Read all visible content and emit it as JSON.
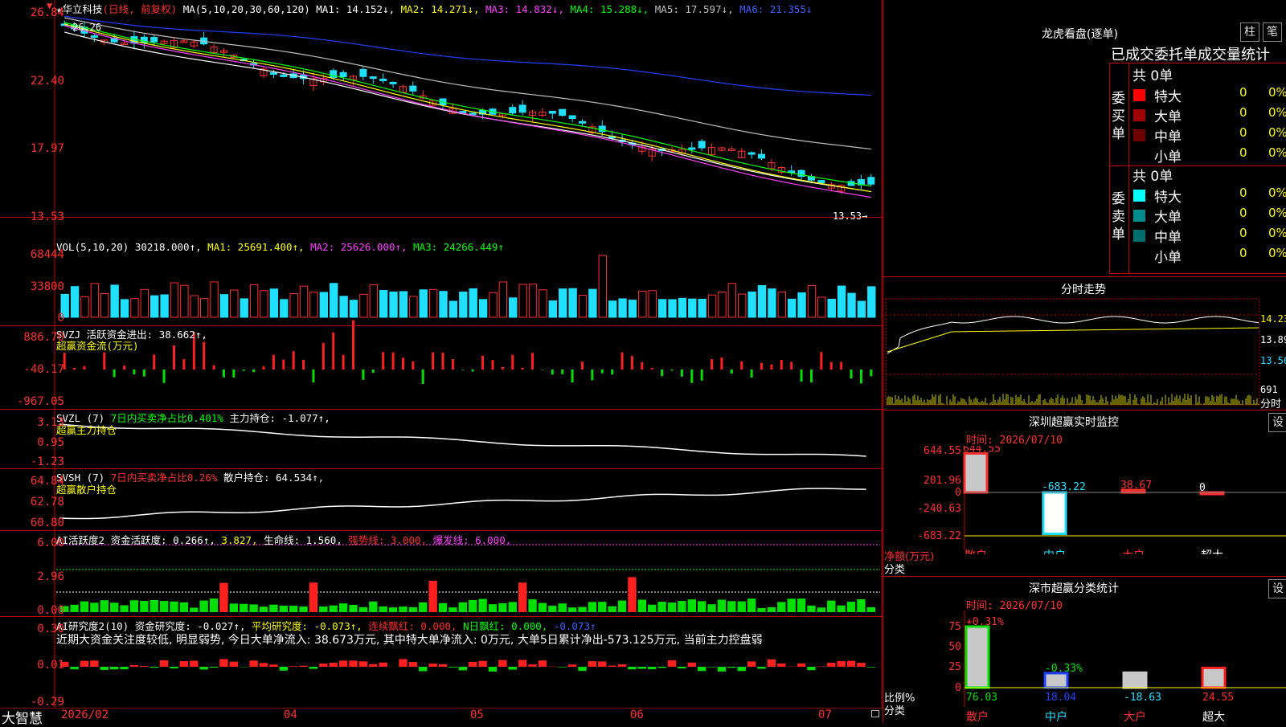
{
  "stock": {
    "star": "★",
    "name": "华立科技",
    "period": "(日线, 前复权)",
    "ma_label": "MA(5,10,20,30,60,120)",
    "ma1": "MA1: 14.152↓,",
    "ma2": "MA2: 14.271↓,",
    "ma3": "MA3: 14.832↓,",
    "ma4": "MA4: 15.288↓,",
    "ma5": "MA5: 17.597↓,",
    "ma6": "MA6: 21.355↓",
    "price_axis": [
      "26.84",
      "22.40",
      "17.97",
      "13.53"
    ],
    "high_mark": "26.26",
    "last_mark": "13.53→",
    "colors": {
      "up": "#ff3030",
      "down": "#20e0ff",
      "ma1": "#ffffff",
      "ma2": "#ffff00",
      "ma3": "#ff40ff",
      "ma4": "#00ff00",
      "ma5": "#c0c0c0",
      "ma6": "#2040ff"
    }
  },
  "vol": {
    "label": "VOL(5,10,20)",
    "value": "30218.000↑,",
    "ma1": "MA1: 25691.400↑,",
    "ma2": "MA2: 25626.000↑,",
    "ma3": "MA3: 24266.449↑",
    "axis": [
      "68444",
      "33800",
      "0"
    ]
  },
  "svzj": {
    "label": "SVZJ",
    "desc": "活跃资金进出: 38.662↑,",
    "sub": "超赢资金流(万元)",
    "axis": [
      "886.70",
      "-40.17",
      "-967.05"
    ]
  },
  "svzl": {
    "label": "SVZL (7)",
    "desc": "7日内买卖净占比0.401%",
    "hold": "主力持仓: -1.077↑,",
    "sub": "超赢主力持仓",
    "axis": [
      "3.13",
      "0.95",
      "-1.23"
    ]
  },
  "svsh": {
    "label": "SVSH (7)",
    "desc": "7日内买卖净占比0.26%",
    "hold": "散户持仓: 64.534↑,",
    "sub": "超赢散户持仓",
    "axis": [
      "64.84",
      "62.78",
      "60.80"
    ]
  },
  "ai1": {
    "label": "AI活跃度2",
    "v1": "资金活跃度: 0.266↑,",
    "v2": "3.827,",
    "v3": "生命线: 1.560,",
    "v4": "强势线: 3.000,",
    "v5": "爆发线: 6.000,",
    "axis": [
      "6.00",
      "2.96",
      "0.00"
    ]
  },
  "ai2": {
    "label": "AI研究度2(10)",
    "v1": "资金研究度: -0.027↑,",
    "v2": "平均研究度: -0.073↑,",
    "v3": "连续飘红: 0.000,",
    "v4": "N日飘红: 0.000,",
    "v5": "-0.073↑",
    "comment": "近期大资金关注度较低, 明显弱势, 今日大单净流入: 38.673万元, 其中特大单净流入: 0万元, 大单5日累计净出-573.125万元, 当前主力控盘弱",
    "axis": [
      "0.30",
      "0.01",
      "-0.29"
    ]
  },
  "xaxis": {
    "brand": "大智慧",
    "labels": [
      "2026/02",
      "04",
      "05",
      "06",
      "07"
    ]
  },
  "right": {
    "lhb_title": "龙虎看盘(逐单)",
    "btn1": "柱",
    "btn2": "笔",
    "stats_title": "已成交委托单成交量统计",
    "buy_label": "委买单",
    "sell_label": "委卖单",
    "buy_total": "共 0单",
    "sell_total": "共 0单",
    "buy_rows": [
      {
        "name": "特大",
        "count": "0",
        "pct": "0%",
        "color": "#ff0000"
      },
      {
        "name": "大单",
        "count": "0",
        "pct": "0%",
        "color": "#a00000"
      },
      {
        "name": "中单",
        "count": "0",
        "pct": "0%",
        "color": "#700000"
      },
      {
        "name": "小单",
        "count": "0",
        "pct": "0%",
        "color": "#000000"
      }
    ],
    "sell_rows": [
      {
        "name": "特大",
        "count": "0",
        "pct": "0%",
        "color": "#00ffff"
      },
      {
        "name": "大单",
        "count": "0",
        "pct": "0%",
        "color": "#008c8c"
      },
      {
        "name": "中单",
        "count": "0",
        "pct": "0%",
        "color": "#006e6e"
      },
      {
        "name": "小单",
        "count": "0",
        "pct": "0%",
        "color": "#000000"
      }
    ],
    "fs_title": "分时走势",
    "fs_axis": [
      "14.23",
      "13.89",
      "13.56"
    ],
    "fs_vol": "691",
    "fs_unit": "分时",
    "sz_title": "深圳超赢实时监控",
    "sz_btn": "设",
    "sz_time": "时间: 2026/07/10",
    "sz_axis": [
      "644.55",
      "201.96",
      "0",
      "-240.63",
      "-683.22"
    ],
    "sz_values": [
      {
        "label": "散户",
        "value": 644.55,
        "text": "644.55"
      },
      {
        "label": "中户",
        "value": -683.22,
        "text": "-683.22"
      },
      {
        "label": "大户",
        "value": 38.67,
        "text": "38.67"
      },
      {
        "label": "超大",
        "value": 0,
        "text": "0"
      }
    ],
    "sz_yname": "净额(万元)",
    "sz_xname": "分类",
    "cls_title": "深市超赢分类统计",
    "cls_btn": "设",
    "cls_time": "时间: 2026/07/10",
    "cls_axis": [
      "75",
      "50",
      "25",
      "0"
    ],
    "cls_values": [
      {
        "label": "散户",
        "value": 76.03,
        "text": "76.03",
        "chg": "+0.31%"
      },
      {
        "label": "中户",
        "value": 18.04,
        "text": "18.04",
        "chg": "-0.33%"
      },
      {
        "label": "大户",
        "value": -18.63,
        "text": "-18.63",
        "chg": ""
      },
      {
        "label": "超大",
        "value": 24.55,
        "text": "24.55",
        "chg": ""
      }
    ],
    "cls_yname": "比例%",
    "cls_xname": "分类"
  }
}
